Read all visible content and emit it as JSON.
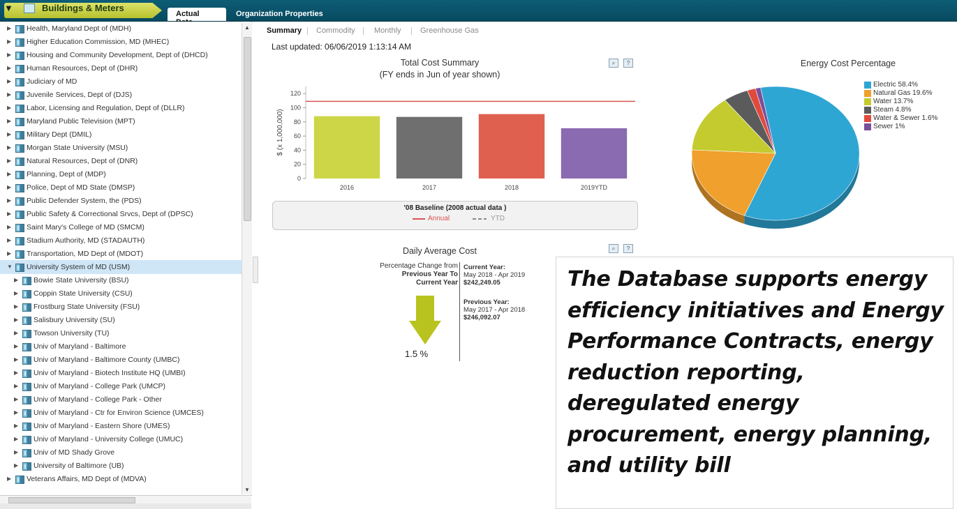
{
  "header": {
    "module_title": "Buildings & Meters",
    "tabs": [
      {
        "label": "Actual Data",
        "active": true
      },
      {
        "label": "Organization Properties",
        "active": false
      }
    ]
  },
  "tree": {
    "items": [
      {
        "label": "Health, Maryland Dept of (MDH)",
        "level": 0,
        "expanded": false,
        "selected": false
      },
      {
        "label": "Higher Education Commission, MD (MHEC)",
        "level": 0,
        "expanded": false,
        "selected": false
      },
      {
        "label": "Housing and Community Development, Dept of (DHCD)",
        "level": 0,
        "expanded": false,
        "selected": false
      },
      {
        "label": "Human Resources, Dept of (DHR)",
        "level": 0,
        "expanded": false,
        "selected": false
      },
      {
        "label": "Judiciary of MD",
        "level": 0,
        "expanded": false,
        "selected": false
      },
      {
        "label": "Juvenile Services, Dept of (DJS)",
        "level": 0,
        "expanded": false,
        "selected": false
      },
      {
        "label": "Labor, Licensing and Regulation, Dept of (DLLR)",
        "level": 0,
        "expanded": false,
        "selected": false
      },
      {
        "label": "Maryland Public Television (MPT)",
        "level": 0,
        "expanded": false,
        "selected": false
      },
      {
        "label": "Military Dept (DMIL)",
        "level": 0,
        "expanded": false,
        "selected": false
      },
      {
        "label": "Morgan State University (MSU)",
        "level": 0,
        "expanded": false,
        "selected": false
      },
      {
        "label": "Natural Resources, Dept of (DNR)",
        "level": 0,
        "expanded": false,
        "selected": false
      },
      {
        "label": "Planning, Dept of (MDP)",
        "level": 0,
        "expanded": false,
        "selected": false
      },
      {
        "label": "Police, Dept of MD State (DMSP)",
        "level": 0,
        "expanded": false,
        "selected": false
      },
      {
        "label": "Public Defender System, the (PDS)",
        "level": 0,
        "expanded": false,
        "selected": false
      },
      {
        "label": "Public Safety & Correctional Srvcs, Dept of (DPSC)",
        "level": 0,
        "expanded": false,
        "selected": false
      },
      {
        "label": "Saint Mary's College of MD (SMCM)",
        "level": 0,
        "expanded": false,
        "selected": false
      },
      {
        "label": "Stadium Authority, MD (STADAUTH)",
        "level": 0,
        "expanded": false,
        "selected": false
      },
      {
        "label": "Transportation, MD Dept of (MDOT)",
        "level": 0,
        "expanded": false,
        "selected": false
      },
      {
        "label": "University System of MD (USM)",
        "level": 0,
        "expanded": true,
        "selected": true
      },
      {
        "label": "Bowie State University (BSU)",
        "level": 1,
        "expanded": false,
        "selected": false
      },
      {
        "label": "Coppin State University (CSU)",
        "level": 1,
        "expanded": false,
        "selected": false
      },
      {
        "label": "Frostburg State University (FSU)",
        "level": 1,
        "expanded": false,
        "selected": false
      },
      {
        "label": "Salisbury University (SU)",
        "level": 1,
        "expanded": false,
        "selected": false
      },
      {
        "label": "Towson University (TU)",
        "level": 1,
        "expanded": false,
        "selected": false
      },
      {
        "label": "Univ of Maryland - Baltimore",
        "level": 1,
        "expanded": false,
        "selected": false
      },
      {
        "label": "Univ of Maryland - Baltimore County (UMBC)",
        "level": 1,
        "expanded": false,
        "selected": false
      },
      {
        "label": "Univ of Maryland - Biotech Institute HQ (UMBI)",
        "level": 1,
        "expanded": false,
        "selected": false
      },
      {
        "label": "Univ of Maryland - College Park (UMCP)",
        "level": 1,
        "expanded": false,
        "selected": false
      },
      {
        "label": "Univ of Maryland - College Park - Other",
        "level": 1,
        "expanded": false,
        "selected": false
      },
      {
        "label": "Univ of Maryland - Ctr for Environ Science (UMCES)",
        "level": 1,
        "expanded": false,
        "selected": false
      },
      {
        "label": "Univ of Maryland - Eastern Shore (UMES)",
        "level": 1,
        "expanded": false,
        "selected": false
      },
      {
        "label": "Univ of Maryland - University College (UMUC)",
        "level": 1,
        "expanded": false,
        "selected": false
      },
      {
        "label": "Univ of MD Shady Grove",
        "level": 1,
        "expanded": false,
        "selected": false
      },
      {
        "label": "University of Baltimore (UB)",
        "level": 1,
        "expanded": false,
        "selected": false
      },
      {
        "label": "Veterans Affairs, MD Dept of (MDVA)",
        "level": 0,
        "expanded": false,
        "selected": false
      }
    ]
  },
  "subtabs": [
    {
      "label": "Summary",
      "active": true
    },
    {
      "label": "Commodity",
      "active": false
    },
    {
      "label": "Monthly",
      "active": false
    },
    {
      "label": "Greenhouse Gas",
      "active": false
    }
  ],
  "last_updated": "Last updated:   06/06/2019 1:13:14 AM",
  "cost_legend": {
    "title": "'08 Baseline (2008 actual data )",
    "annual": "Annual",
    "ytd": "YTD"
  },
  "daily": {
    "title": "Daily Average Cost",
    "pct_label_1": "Percentage Change from",
    "pct_label_2": "Previous Year To",
    "pct_label_3": "Current Year",
    "pct_value": "1.5 %",
    "current_heading": "Current Year:",
    "current_range": "May 2018 - Apr 2019",
    "current_value": "$242,249.05",
    "previous_heading": "Previous Year:",
    "previous_range": "May 2017 - Apr 2018",
    "previous_value": "$246,092.07",
    "direction": "down"
  },
  "callout": {
    "text": "The Database supports energy efficiency initiatives and Energy Performance Contracts, energy reduction reporting, deregulated energy procurement, energy planning, and utility bill"
  },
  "chart_data": [
    {
      "type": "bar",
      "title": "Total Cost Summary",
      "subtitle": "(FY ends in Jun of year shown)",
      "xlabel": "",
      "ylabel": "$ (x 1,000,000)",
      "categories": [
        "2016",
        "2017",
        "2018",
        "2019YTD"
      ],
      "values": [
        88,
        87,
        91,
        71
      ],
      "colors": [
        "#cdd646",
        "#6f6f6f",
        "#e06050",
        "#8a6ab0"
      ],
      "yticks": [
        0,
        20,
        40,
        60,
        80,
        100,
        120
      ],
      "ylim": [
        0,
        130
      ],
      "baseline_annual": 109,
      "baseline_color": "#d9534f",
      "grid": false
    },
    {
      "type": "pie",
      "title": "Energy Cost Percentage",
      "labels": [
        "Electric 58.4%",
        "Natural Gas 19.6%",
        "Water 13.7%",
        "Steam 4.8%",
        "Water & Sewer 1.6%",
        "Sewer 1%"
      ],
      "values": [
        58.4,
        19.6,
        13.7,
        4.8,
        1.6,
        1
      ],
      "colors": [
        "#2ea6d4",
        "#f0a02c",
        "#c3cb2f",
        "#5b5b5b",
        "#e04a3c",
        "#7b4e9a"
      ],
      "legend": "right"
    }
  ]
}
